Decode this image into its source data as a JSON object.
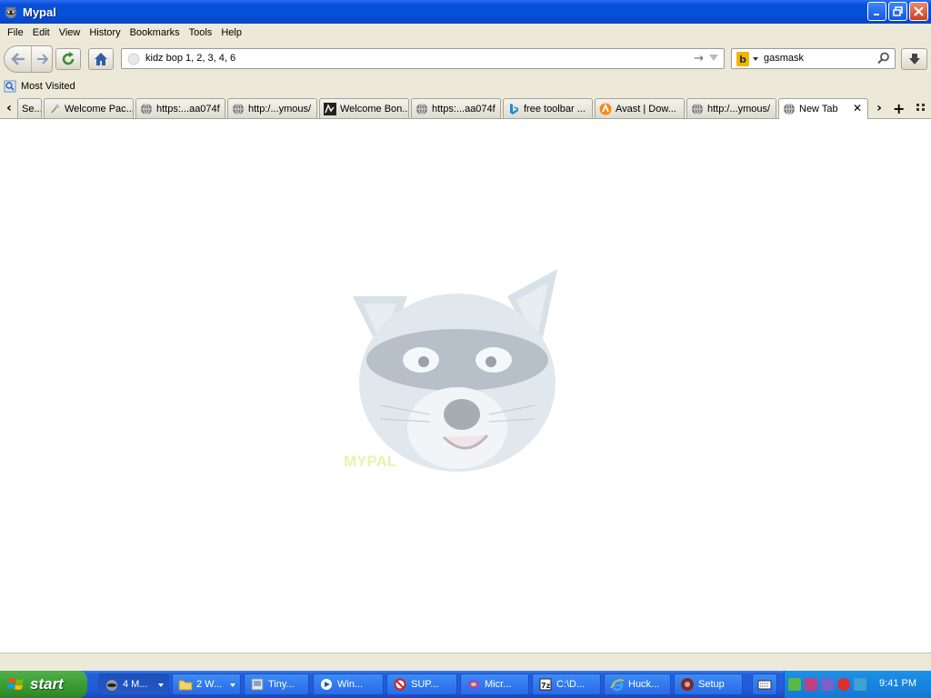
{
  "window": {
    "title": "Mypal"
  },
  "menu": [
    "File",
    "Edit",
    "View",
    "History",
    "Bookmarks",
    "Tools",
    "Help"
  ],
  "navbar": {
    "url": "kidz bop 1, 2, 3, 4, 6",
    "search_query": "gasmask",
    "search_engine_icon": "bing-icon"
  },
  "bookmarks": {
    "most_visited": "Most Visited"
  },
  "tabs": [
    {
      "label": "Se...",
      "icon": "generic"
    },
    {
      "label": "Welcome Pac...",
      "icon": "pin"
    },
    {
      "label": "https:...aa074f",
      "icon": "globe"
    },
    {
      "label": "http:/...ymous/",
      "icon": "globe"
    },
    {
      "label": "Welcome Bon...",
      "icon": "bonzi"
    },
    {
      "label": "https:...aa074f",
      "icon": "globe"
    },
    {
      "label": "free toolbar ...",
      "icon": "bing"
    },
    {
      "label": "Avast | Dow...",
      "icon": "avast"
    },
    {
      "label": "http:/...ymous/",
      "icon": "globe"
    },
    {
      "label": "New Tab",
      "icon": "globe",
      "active": true
    }
  ],
  "content": {
    "brand": "MYPAL"
  },
  "taskbar": {
    "start": "start",
    "tasks": [
      {
        "label": "4 M...",
        "icon": "raccoon",
        "pressed": true,
        "group": true
      },
      {
        "label": "2 W...",
        "icon": "folder",
        "group": true
      },
      {
        "label": "Tiny...",
        "icon": "app"
      },
      {
        "label": "Win...",
        "icon": "media"
      },
      {
        "label": "SUP...",
        "icon": "no"
      },
      {
        "label": "Micr...",
        "icon": "ms"
      },
      {
        "label": "C:\\D...",
        "icon": "7z"
      },
      {
        "label": "Huck...",
        "icon": "ie"
      },
      {
        "label": "Setup",
        "icon": "setup"
      }
    ],
    "clock": "9:41 PM"
  },
  "colors": {
    "titlebar": "#0551d9",
    "chrome": "#ece9d8",
    "taskbar": "#245edb",
    "start": "#379a31",
    "tray": "#1478d4"
  }
}
